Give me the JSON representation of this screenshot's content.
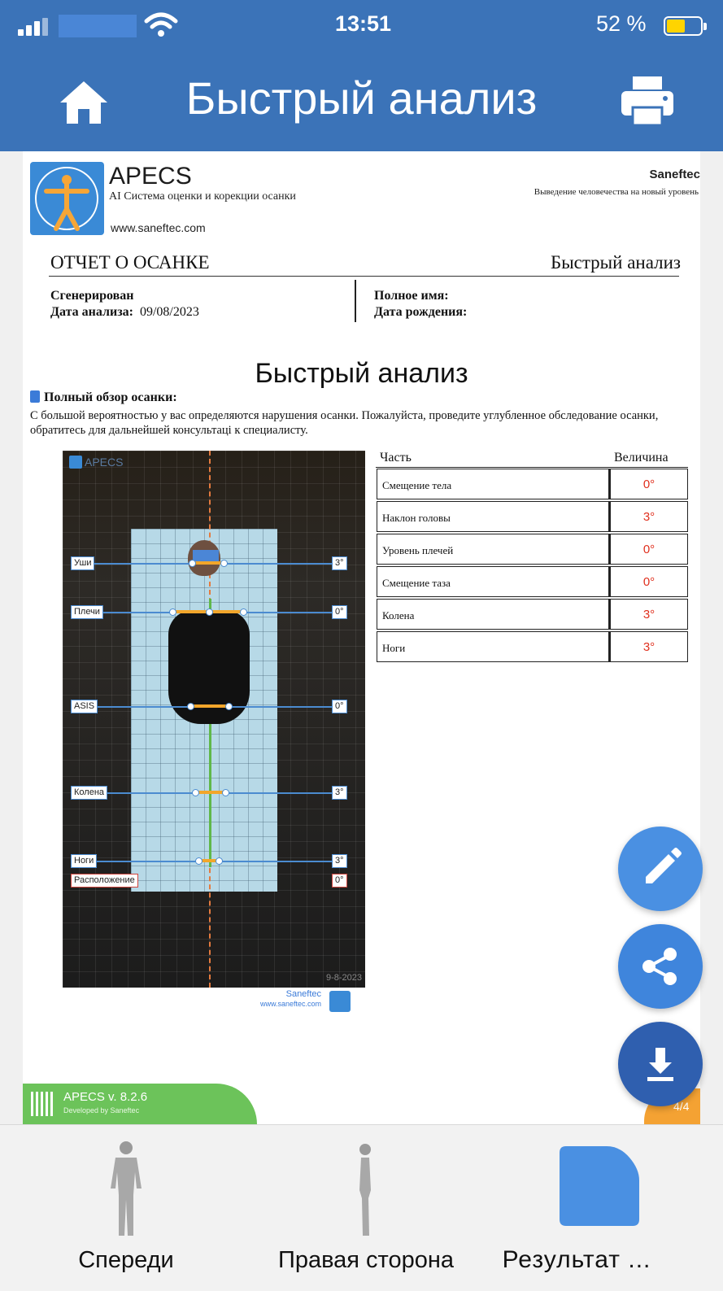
{
  "status_bar": {
    "time": "13:51",
    "battery": "52 %"
  },
  "header": {
    "title": "Быстрый анализ",
    "home_icon": "home-icon",
    "print_icon": "printer-icon"
  },
  "report": {
    "brand": "APECS",
    "brand_subtitle": "AI  Система оценки и корекции осанки",
    "website": "www.saneftec.com",
    "company": "Saneftec",
    "slogan": "Выведение человечества на новый уровень",
    "report_title": "ОТЧЕТ О ОСАНКЕ",
    "report_type": "Быстрый анализ",
    "generated_label": "Сгенерирован",
    "analysis_date_label": "Дата анализа:",
    "analysis_date": "09/08/2023",
    "full_name_label": "Полное имя:",
    "birth_date_label": "Дата рождения:",
    "section_title": "Быстрый анализ",
    "overview_title": "Полный обзор осанки:",
    "overview_text": "С большой вероятностью  у вас определяются нарушения осанки. Пожалуйста, проведите углубленное обследование осанки, обратитесь для дальнейшей консультаці к специалисту.",
    "photo": {
      "brand": "APECS",
      "date": "9-8-2023",
      "footer_company": "Saneftec",
      "footer_url": "www.saneftec.com",
      "measurements": [
        {
          "label": "Уши",
          "value": "3°"
        },
        {
          "label": "Плечи",
          "value": "0°"
        },
        {
          "label": "ASIS",
          "value": "0°"
        },
        {
          "label": "Колена",
          "value": "3°"
        },
        {
          "label": "Ноги",
          "value": "3°"
        },
        {
          "label": "Расположение",
          "value": "0°"
        }
      ]
    },
    "table": {
      "col_part": "Часть",
      "col_value": "Величина",
      "rows": [
        {
          "part": "Смещение тела",
          "value": "0°"
        },
        {
          "part": "Наклон головы",
          "value": "3°"
        },
        {
          "part": "Уровень плечей",
          "value": "0°"
        },
        {
          "part": "Смещение таза",
          "value": "0°"
        },
        {
          "part": "Колена",
          "value": "3°"
        },
        {
          "part": "Ноги",
          "value": "3°"
        }
      ]
    },
    "version": "APECS v. 8.2.6",
    "developer": "Developed by Saneftec",
    "page": "4/4"
  },
  "fabs": {
    "edit_icon": "pencil-icon",
    "share_icon": "share-icon",
    "download_icon": "download-icon"
  },
  "tabs": [
    {
      "label": "Спереди",
      "icon": "front-body-icon"
    },
    {
      "label": "Правая сторона",
      "icon": "side-body-icon"
    },
    {
      "label": "Результат ...",
      "icon": "result-icon"
    }
  ],
  "colors": {
    "header": "#3b73b8",
    "accent": "#4a90e2",
    "value_red": "#e0301e",
    "version_green": "#6cc35a",
    "page_orange": "#f4a233"
  }
}
